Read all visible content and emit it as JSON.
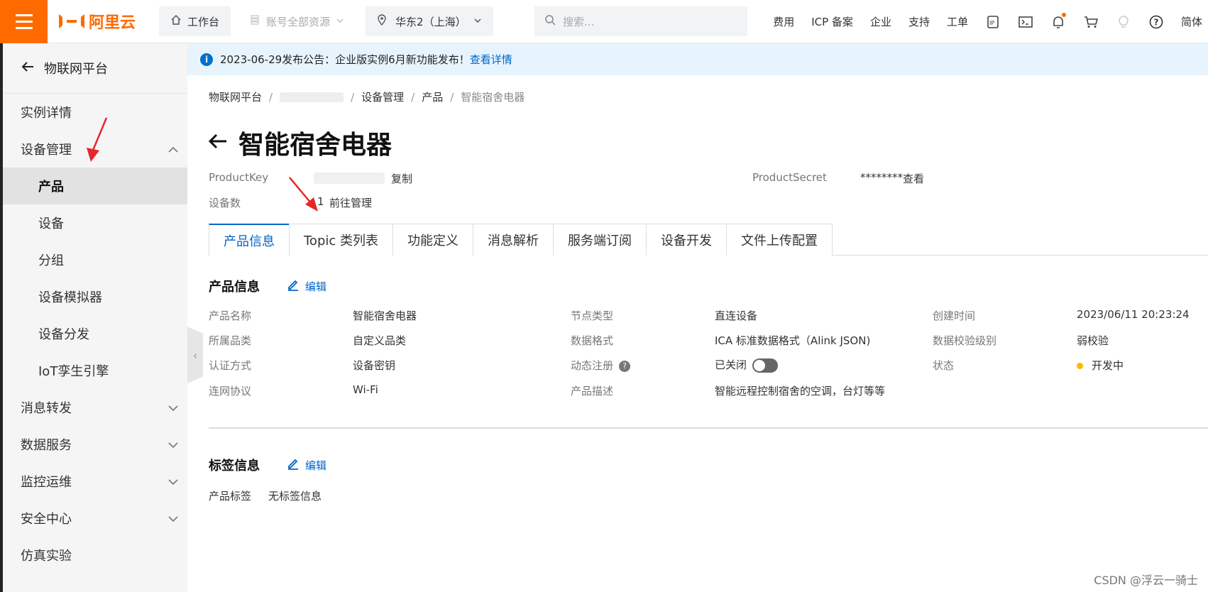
{
  "topbar": {
    "logo_text": "阿里云",
    "workbench": "工作台",
    "resources": "账号全部资源",
    "region": "华东2（上海）",
    "search_placeholder": "搜索...",
    "links": [
      "费用",
      "ICP 备案",
      "企业",
      "支持",
      "工单"
    ],
    "lang": "简体"
  },
  "sidebar": {
    "back_label": "物联网平台",
    "items": [
      {
        "label": "实例详情",
        "level": 1,
        "chevron": ""
      },
      {
        "label": "设备管理",
        "level": 1,
        "chevron": "up"
      },
      {
        "label": "产品",
        "level": 2,
        "active": true
      },
      {
        "label": "设备",
        "level": 2
      },
      {
        "label": "分组",
        "level": 2
      },
      {
        "label": "设备模拟器",
        "level": 2
      },
      {
        "label": "设备分发",
        "level": 2
      },
      {
        "label": "IoT孪生引擎",
        "level": 2
      },
      {
        "label": "消息转发",
        "level": 1,
        "chevron": "down"
      },
      {
        "label": "数据服务",
        "level": 1,
        "chevron": "down"
      },
      {
        "label": "监控运维",
        "level": 1,
        "chevron": "down"
      },
      {
        "label": "安全中心",
        "level": 1,
        "chevron": "down"
      },
      {
        "label": "仿真实验",
        "level": 1,
        "chevron": ""
      }
    ]
  },
  "notice": {
    "text": "2023-06-29发布公告：企业版实例6月新功能发布！",
    "link": "查看详情"
  },
  "breadcrumb": {
    "first": "物联网平台",
    "items": [
      "设备管理",
      "产品",
      "智能宿舍电器"
    ]
  },
  "page": {
    "title": "智能宿舍电器",
    "product_key_label": "ProductKey",
    "copy": "复制",
    "product_secret_label": "ProductSecret",
    "product_secret_value": "********",
    "view": "查看",
    "device_count_label": "设备数",
    "device_count": "1",
    "manage": "前往管理"
  },
  "tabs": [
    "产品信息",
    "Topic 类列表",
    "功能定义",
    "消息解析",
    "服务端订阅",
    "设备开发",
    "文件上传配置"
  ],
  "product_info": {
    "heading": "产品信息",
    "edit": "编辑",
    "fields": {
      "name_label": "产品名称",
      "name": "智能宿舍电器",
      "node_label": "节点类型",
      "node": "直连设备",
      "created_label": "创建时间",
      "created": "2023/06/11 20:23:24",
      "category_label": "所属品类",
      "category": "自定义品类",
      "format_label": "数据格式",
      "format": "ICA 标准数据格式（Alink JSON)",
      "check_label": "数据校验级别",
      "check": "弱校验",
      "auth_label": "认证方式",
      "auth": "设备密钥",
      "dynreg_label": "动态注册",
      "dynreg": "已关闭",
      "status_label": "状态",
      "status": "开发中",
      "protocol_label": "连网协议",
      "protocol": "Wi-Fi",
      "desc_label": "产品描述",
      "desc": "智能远程控制宿舍的空调，台灯等等"
    }
  },
  "tag_info": {
    "heading": "标签信息",
    "edit": "编辑",
    "label": "产品标签",
    "value": "无标签信息"
  },
  "watermark": "CSDN @浮云一骑士",
  "colors": {
    "brand": "#ff6a00",
    "link": "#0064c8",
    "status_dev": "#f9b900",
    "annotation_arrow": "#e8262a"
  }
}
